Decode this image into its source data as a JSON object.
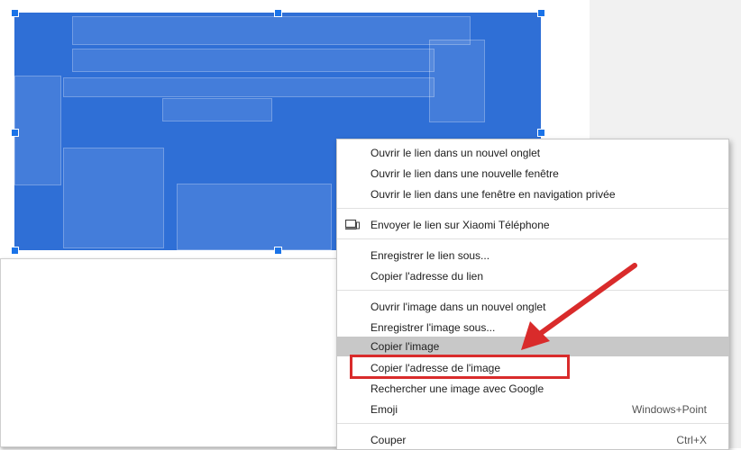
{
  "context_menu": {
    "items": [
      {
        "label": "Ouvrir le lien dans un nouvel onglet",
        "shortcut": ""
      },
      {
        "label": "Ouvrir le lien dans une nouvelle fenêtre",
        "shortcut": ""
      },
      {
        "label": "Ouvrir le lien dans une fenêtre en navigation privée",
        "shortcut": ""
      },
      {
        "label": "Envoyer le lien sur Xiaomi Téléphone",
        "shortcut": ""
      },
      {
        "label": "Enregistrer le lien sous...",
        "shortcut": ""
      },
      {
        "label": "Copier l'adresse du lien",
        "shortcut": ""
      },
      {
        "label": "Ouvrir l'image dans un nouvel onglet",
        "shortcut": ""
      },
      {
        "label": "Enregistrer l'image sous...",
        "shortcut": ""
      },
      {
        "label": "Copier l'image",
        "shortcut": ""
      },
      {
        "label": "Copier l'adresse de l'image",
        "shortcut": ""
      },
      {
        "label": "Rechercher une image avec Google",
        "shortcut": ""
      },
      {
        "label": "Emoji",
        "shortcut": "Windows+Point"
      },
      {
        "label": "Couper",
        "shortcut": "Ctrl+X"
      }
    ]
  },
  "colors": {
    "selection_overlay": "#2f6fd6",
    "highlight": "#d92b2b",
    "hover": "#c8c8c8"
  },
  "icons": {
    "send_to_device": "device-icon"
  }
}
